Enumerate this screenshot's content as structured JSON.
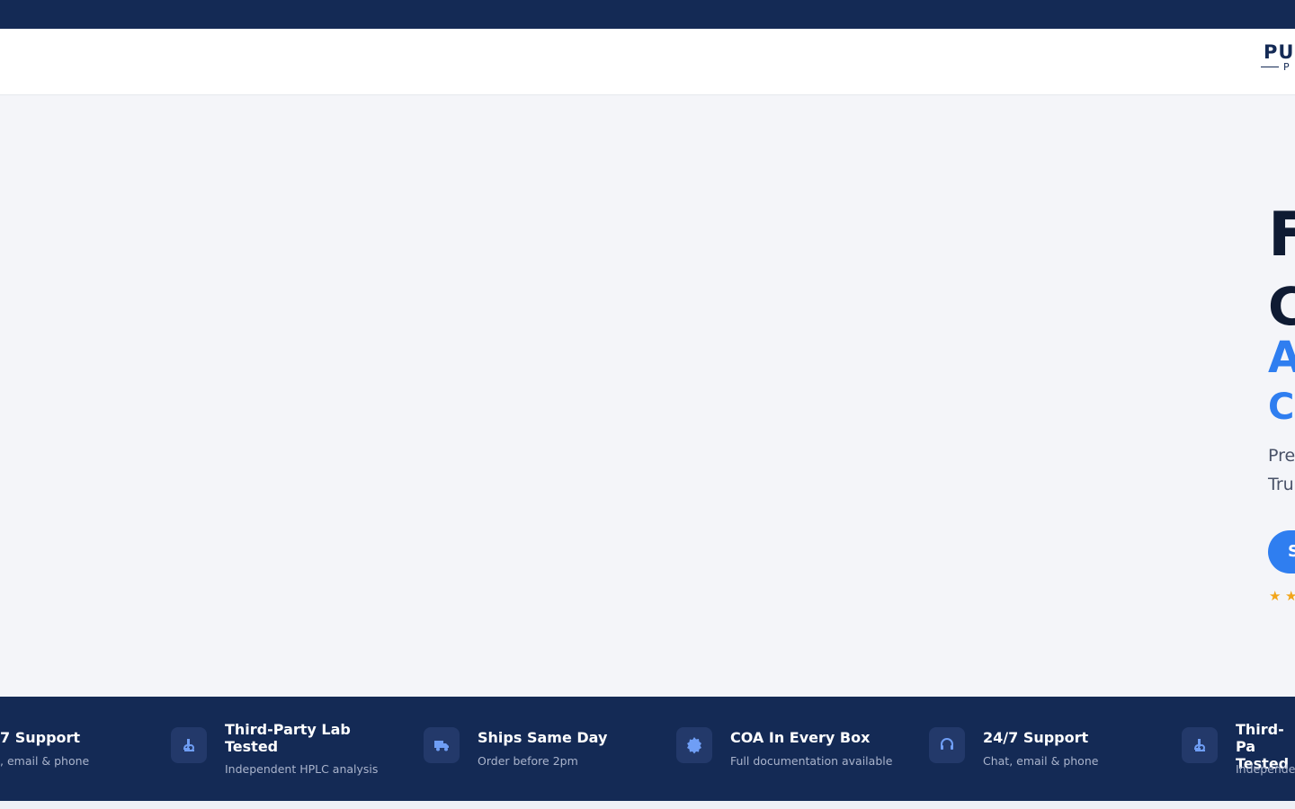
{
  "header": {
    "logo_text": "PU",
    "logo_sub": "P"
  },
  "hero": {
    "title_line_1": "F",
    "title_line_2": "C",
    "title_line_3": "A",
    "title_line_4": "C",
    "desc_line_1": "Pre",
    "desc_line_2": "Tru",
    "cta_label": "S",
    "stars": [
      "★",
      "★"
    ]
  },
  "features": [
    {
      "title": "7 Support",
      "subtitle": ", email & phone",
      "icon": "headset-icon"
    },
    {
      "title": "Third-Party Lab Tested",
      "subtitle": "Independent HPLC analysis",
      "icon": "microscope-icon"
    },
    {
      "title": "Ships Same Day",
      "subtitle": "Order before 2pm",
      "icon": "truck-icon"
    },
    {
      "title": "COA In Every Box",
      "subtitle": "Full documentation available",
      "icon": "badge-icon"
    },
    {
      "title": "24/7 Support",
      "subtitle": "Chat, email & phone",
      "icon": "headset-icon"
    },
    {
      "title": "Third-Pa Tested",
      "subtitle": "Independe",
      "icon": "microscope-icon"
    }
  ],
  "colors": {
    "navy": "#142a55",
    "accent": "#2f7ef0",
    "star": "#f2a51a"
  }
}
